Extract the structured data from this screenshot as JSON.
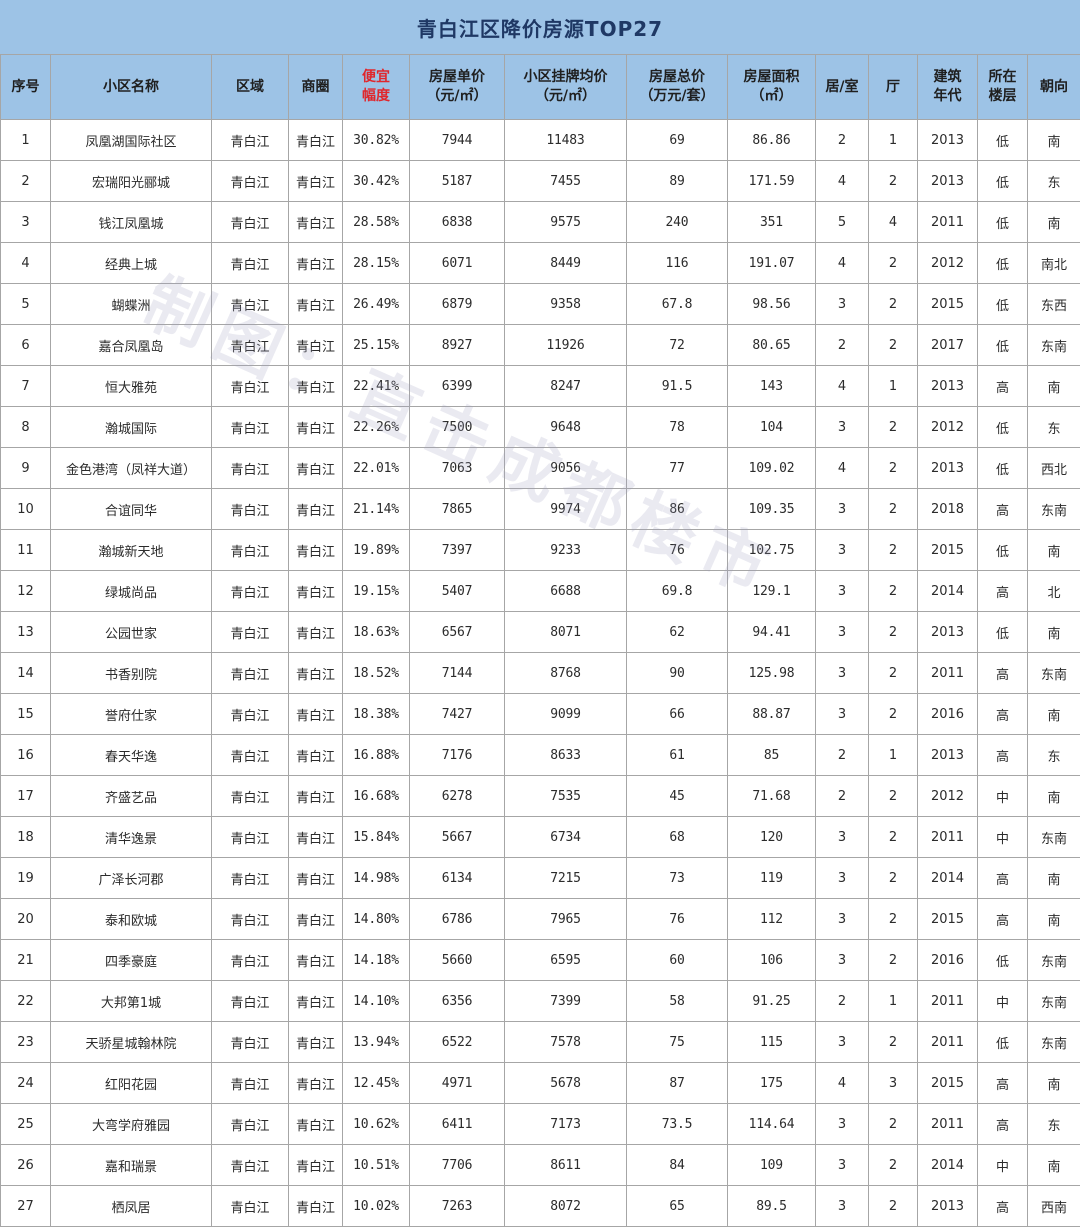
{
  "title": "青白江区降价房源TOP27",
  "watermark": "制图：直击成都楼市",
  "columns": [
    {
      "key": "idx",
      "line1": "序号",
      "line2": ""
    },
    {
      "key": "name",
      "line1": "小区名称",
      "line2": ""
    },
    {
      "key": "region",
      "line1": "区域",
      "line2": ""
    },
    {
      "key": "area",
      "line1": "商圈",
      "line2": ""
    },
    {
      "key": "discount",
      "line1": "便宜",
      "line2": "幅度"
    },
    {
      "key": "unit_price",
      "line1": "房屋单价",
      "line2": "（元/㎡）"
    },
    {
      "key": "avg_price",
      "line1": "小区挂牌均价",
      "line2": "（元/㎡）"
    },
    {
      "key": "total_price",
      "line1": "房屋总价",
      "line2": "（万元/套）"
    },
    {
      "key": "size",
      "line1": "房屋面积",
      "line2": "（㎡）"
    },
    {
      "key": "rooms",
      "line1": "居/室",
      "line2": ""
    },
    {
      "key": "halls",
      "line1": "厅",
      "line2": ""
    },
    {
      "key": "year",
      "line1": "建筑",
      "line2": "年代"
    },
    {
      "key": "floor",
      "line1": "所在",
      "line2": "楼层"
    },
    {
      "key": "orient",
      "line1": "朝向",
      "line2": ""
    }
  ],
  "rows": [
    [
      "1",
      "凤凰湖国际社区",
      "青白江",
      "青白江",
      "30.82%",
      "7944",
      "11483",
      "69",
      "86.86",
      "2",
      "1",
      "2013",
      "低",
      "南"
    ],
    [
      "2",
      "宏瑞阳光郦城",
      "青白江",
      "青白江",
      "30.42%",
      "5187",
      "7455",
      "89",
      "171.59",
      "4",
      "2",
      "2013",
      "低",
      "东"
    ],
    [
      "3",
      "钱江凤凰城",
      "青白江",
      "青白江",
      "28.58%",
      "6838",
      "9575",
      "240",
      "351",
      "5",
      "4",
      "2011",
      "低",
      "南"
    ],
    [
      "4",
      "经典上城",
      "青白江",
      "青白江",
      "28.15%",
      "6071",
      "8449",
      "116",
      "191.07",
      "4",
      "2",
      "2012",
      "低",
      "南北"
    ],
    [
      "5",
      "蝴蝶洲",
      "青白江",
      "青白江",
      "26.49%",
      "6879",
      "9358",
      "67.8",
      "98.56",
      "3",
      "2",
      "2015",
      "低",
      "东西"
    ],
    [
      "6",
      "嘉合凤凰岛",
      "青白江",
      "青白江",
      "25.15%",
      "8927",
      "11926",
      "72",
      "80.65",
      "2",
      "2",
      "2017",
      "低",
      "东南"
    ],
    [
      "7",
      "恒大雅苑",
      "青白江",
      "青白江",
      "22.41%",
      "6399",
      "8247",
      "91.5",
      "143",
      "4",
      "1",
      "2013",
      "高",
      "南"
    ],
    [
      "8",
      "瀚城国际",
      "青白江",
      "青白江",
      "22.26%",
      "7500",
      "9648",
      "78",
      "104",
      "3",
      "2",
      "2012",
      "低",
      "东"
    ],
    [
      "9",
      "金色港湾（凤祥大道）",
      "青白江",
      "青白江",
      "22.01%",
      "7063",
      "9056",
      "77",
      "109.02",
      "4",
      "2",
      "2013",
      "低",
      "西北"
    ],
    [
      "10",
      "合谊同华",
      "青白江",
      "青白江",
      "21.14%",
      "7865",
      "9974",
      "86",
      "109.35",
      "3",
      "2",
      "2018",
      "高",
      "东南"
    ],
    [
      "11",
      "瀚城新天地",
      "青白江",
      "青白江",
      "19.89%",
      "7397",
      "9233",
      "76",
      "102.75",
      "3",
      "2",
      "2015",
      "低",
      "南"
    ],
    [
      "12",
      "绿城尚品",
      "青白江",
      "青白江",
      "19.15%",
      "5407",
      "6688",
      "69.8",
      "129.1",
      "3",
      "2",
      "2014",
      "高",
      "北"
    ],
    [
      "13",
      "公园世家",
      "青白江",
      "青白江",
      "18.63%",
      "6567",
      "8071",
      "62",
      "94.41",
      "3",
      "2",
      "2013",
      "低",
      "南"
    ],
    [
      "14",
      "书香别院",
      "青白江",
      "青白江",
      "18.52%",
      "7144",
      "8768",
      "90",
      "125.98",
      "3",
      "2",
      "2011",
      "高",
      "东南"
    ],
    [
      "15",
      "誉府仕家",
      "青白江",
      "青白江",
      "18.38%",
      "7427",
      "9099",
      "66",
      "88.87",
      "3",
      "2",
      "2016",
      "高",
      "南"
    ],
    [
      "16",
      "春天华逸",
      "青白江",
      "青白江",
      "16.88%",
      "7176",
      "8633",
      "61",
      "85",
      "2",
      "1",
      "2013",
      "高",
      "东"
    ],
    [
      "17",
      "齐盛艺品",
      "青白江",
      "青白江",
      "16.68%",
      "6278",
      "7535",
      "45",
      "71.68",
      "2",
      "2",
      "2012",
      "中",
      "南"
    ],
    [
      "18",
      "清华逸景",
      "青白江",
      "青白江",
      "15.84%",
      "5667",
      "6734",
      "68",
      "120",
      "3",
      "2",
      "2011",
      "中",
      "东南"
    ],
    [
      "19",
      "广泽长河郡",
      "青白江",
      "青白江",
      "14.98%",
      "6134",
      "7215",
      "73",
      "119",
      "3",
      "2",
      "2014",
      "高",
      "南"
    ],
    [
      "20",
      "泰和欧城",
      "青白江",
      "青白江",
      "14.80%",
      "6786",
      "7965",
      "76",
      "112",
      "3",
      "2",
      "2015",
      "高",
      "南"
    ],
    [
      "21",
      "四季豪庭",
      "青白江",
      "青白江",
      "14.18%",
      "5660",
      "6595",
      "60",
      "106",
      "3",
      "2",
      "2016",
      "低",
      "东南"
    ],
    [
      "22",
      "大邦第1城",
      "青白江",
      "青白江",
      "14.10%",
      "6356",
      "7399",
      "58",
      "91.25",
      "2",
      "1",
      "2011",
      "中",
      "东南"
    ],
    [
      "23",
      "天骄星城翰林院",
      "青白江",
      "青白江",
      "13.94%",
      "6522",
      "7578",
      "75",
      "115",
      "3",
      "2",
      "2011",
      "低",
      "东南"
    ],
    [
      "24",
      "红阳花园",
      "青白江",
      "青白江",
      "12.45%",
      "4971",
      "5678",
      "87",
      "175",
      "4",
      "3",
      "2015",
      "高",
      "南"
    ],
    [
      "25",
      "大弯学府雅园",
      "青白江",
      "青白江",
      "10.62%",
      "6411",
      "7173",
      "73.5",
      "114.64",
      "3",
      "2",
      "2011",
      "高",
      "东"
    ],
    [
      "26",
      "嘉和瑞景",
      "青白江",
      "青白江",
      "10.51%",
      "7706",
      "8611",
      "84",
      "109",
      "3",
      "2",
      "2014",
      "中",
      "南"
    ],
    [
      "27",
      "栖凤居",
      "青白江",
      "青白江",
      "10.02%",
      "7263",
      "8072",
      "65",
      "89.5",
      "3",
      "2",
      "2013",
      "高",
      "西南"
    ]
  ]
}
